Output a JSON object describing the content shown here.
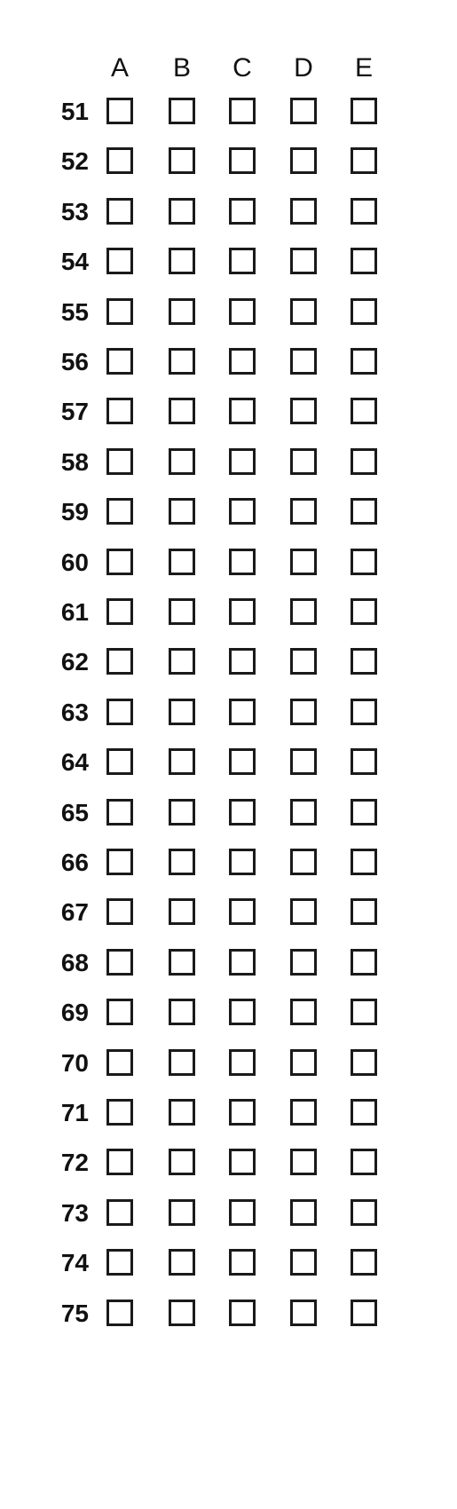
{
  "sheet": {
    "columns": [
      "A",
      "B",
      "C",
      "D",
      "E"
    ],
    "questions": [
      "51",
      "52",
      "53",
      "54",
      "55",
      "56",
      "57",
      "58",
      "59",
      "60",
      "61",
      "62",
      "63",
      "64",
      "65",
      "66",
      "67",
      "68",
      "69",
      "70",
      "71",
      "72",
      "73",
      "74",
      "75"
    ]
  }
}
